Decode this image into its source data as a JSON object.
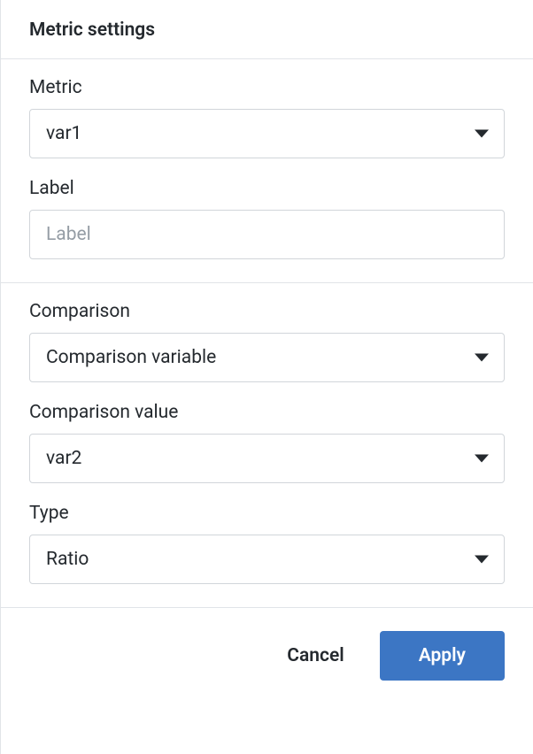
{
  "header": {
    "title": "Metric settings"
  },
  "metric": {
    "label": "Metric",
    "value": "var1"
  },
  "label_field": {
    "label": "Label",
    "value": "",
    "placeholder": "Label"
  },
  "comparison": {
    "label": "Comparison",
    "value": "Comparison variable"
  },
  "comparison_value": {
    "label": "Comparison value",
    "value": "var2"
  },
  "type": {
    "label": "Type",
    "value": "Ratio"
  },
  "footer": {
    "cancel_label": "Cancel",
    "apply_label": "Apply"
  }
}
